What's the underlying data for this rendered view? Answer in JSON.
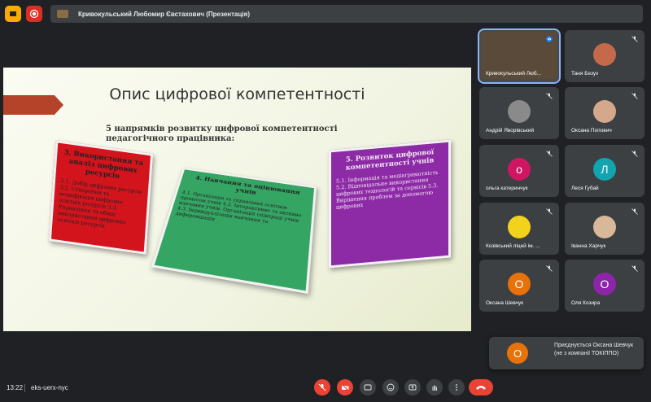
{
  "presentation_bar": {
    "label": "Кривокульський Любомир Євстахович (Презентація)"
  },
  "slide": {
    "title": "Опис цифрової компетентності",
    "subtitle": "5 напрямків розвитку цифрової компетентності педагогічного працівника:",
    "boxes": [
      {
        "title": "3. Використання та аналіз цифрових ресурсів",
        "items": "3.1. Добір цифрових ресурсів 3.2. Створення та модифікація цифрових освітніх ресурсів 3.3. Управління та обмін використання цифрових освітніх ресурсів"
      },
      {
        "title": "4. Навчання та оцінювання учнів",
        "items": "4.1. Організація та управління освітнім процесом учнів 4.2. Інтерактивне та активне навчання учнів. Організація співпраці учнів 4.3. Індивідуалізація навчання та диференціація"
      },
      {
        "title": "5. Розвиток цифрової компетентності учнів",
        "items": "5.1. Інформація та медіаграмотність 5.2. Відповідальне використання цифрових технологій та сервісів 5.3. Вирішення проблем за допомогою цифрових"
      }
    ]
  },
  "participants": [
    {
      "name": "Кривокульський Люб...",
      "initial": "",
      "color": "#5a4a3a"
    },
    {
      "name": "Таня Безух",
      "initial": "",
      "color": "#c46a4a"
    },
    {
      "name": "Андрій Яворівський",
      "initial": "",
      "color": "#8a8a8a"
    },
    {
      "name": "Оксана Попович",
      "initial": "",
      "color": "#d4a88a"
    },
    {
      "name": "ольга катеринчук",
      "initial": "о",
      "color": "#d01563"
    },
    {
      "name": "Леся Губай",
      "initial": "Л",
      "color": "#12a4af"
    },
    {
      "name": "Козівський ліцей ім. ...",
      "initial": "",
      "color": "#f2d21b"
    },
    {
      "name": "Іванна Харчук",
      "initial": "",
      "color": "#d9b899"
    },
    {
      "name": "Оксана Шевчук",
      "initial": "О",
      "color": "#e8710a"
    },
    {
      "name": "Оля Козира",
      "initial": "О",
      "color": "#8e24aa"
    }
  ],
  "toast": {
    "initial": "О",
    "text": "Приєднується Оксана Шевчук (не з компанії ТОКІППО)"
  },
  "bottom": {
    "time": "13:22",
    "code": "eks-uerx-nyc"
  },
  "colors": {
    "background": "#202124",
    "tile": "#3c4043",
    "danger": "#ea4335",
    "accent": "#8ab4f8"
  }
}
